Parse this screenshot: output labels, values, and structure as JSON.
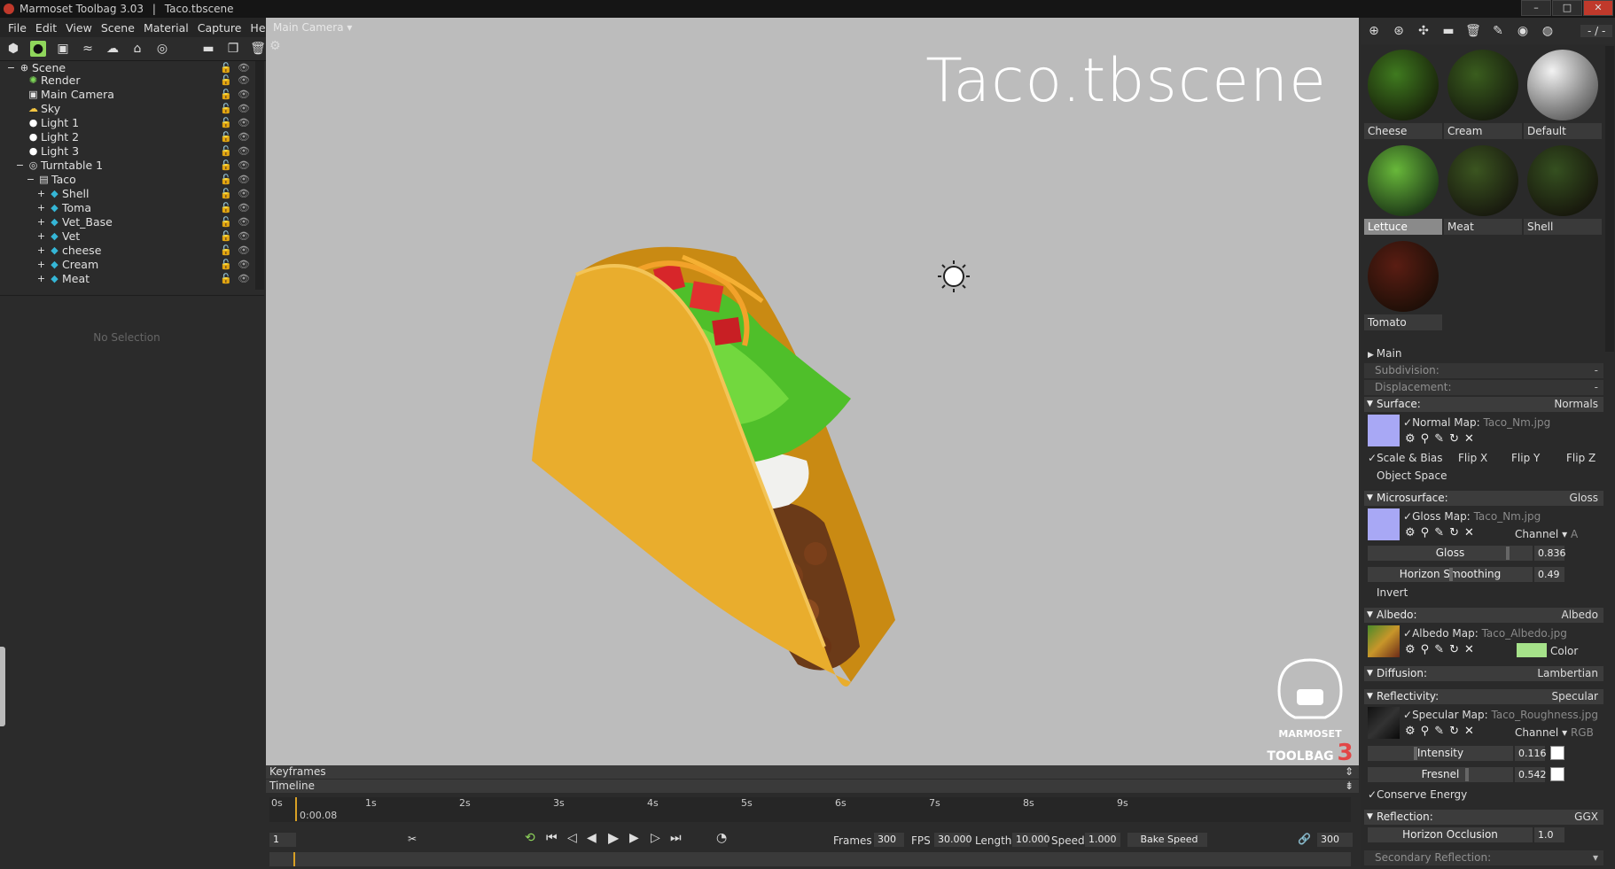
{
  "window": {
    "app_title": "Marmoset Toolbag 3.03",
    "file_title": "Taco.tbscene",
    "separator": "|",
    "minimize": "–",
    "maximize": "□",
    "close": "✕"
  },
  "menu": [
    "File",
    "Edit",
    "View",
    "Scene",
    "Material",
    "Capture",
    "Help"
  ],
  "scene_tree": [
    {
      "label": "Scene",
      "icon": "scene-icon",
      "glyph": "⊕",
      "expander": "−"
    },
    {
      "label": "Render",
      "icon": "render-icon",
      "glyph": "✺",
      "expander": ""
    },
    {
      "label": "Main Camera",
      "icon": "camera-icon",
      "glyph": "▣",
      "expander": ""
    },
    {
      "label": "Sky",
      "icon": "sky-icon",
      "glyph": "☁",
      "expander": ""
    },
    {
      "label": "Light 1",
      "icon": "light-icon",
      "glyph": "●",
      "expander": ""
    },
    {
      "label": "Light 2",
      "icon": "light-icon",
      "glyph": "●",
      "expander": ""
    },
    {
      "label": "Light 3",
      "icon": "light-icon",
      "glyph": "●",
      "expander": ""
    },
    {
      "label": "Turntable 1",
      "icon": "turntable-icon",
      "glyph": "◎",
      "expander": "−"
    },
    {
      "label": "Taco",
      "icon": "model-icon",
      "glyph": "▤",
      "expander": "−"
    },
    {
      "label": "Shell",
      "icon": "mesh-icon",
      "glyph": "◆",
      "expander": "+"
    },
    {
      "label": "Toma",
      "icon": "mesh-icon",
      "glyph": "◆",
      "expander": "+"
    },
    {
      "label": "Vet_Base",
      "icon": "mesh-icon",
      "glyph": "◆",
      "expander": "+"
    },
    {
      "label": "Vet",
      "icon": "mesh-icon",
      "glyph": "◆",
      "expander": "+"
    },
    {
      "label": "cheese",
      "icon": "mesh-icon",
      "glyph": "◆",
      "expander": "+"
    },
    {
      "label": "Cream",
      "icon": "mesh-icon",
      "glyph": "◆",
      "expander": "+"
    },
    {
      "label": "Meat",
      "icon": "mesh-icon",
      "glyph": "◆",
      "expander": "+"
    }
  ],
  "tree_row_controls": {
    "lock": "🔓",
    "eye": "👁"
  },
  "left_panel": {
    "no_selection": "No Selection"
  },
  "viewport": {
    "camera_label": "Main Camera ▾",
    "title": "Taco.tbscene",
    "logo_line1": "MARMOSET",
    "logo_line2": "TOOLBAG",
    "logo_version": "3"
  },
  "right_toolbar": {
    "counter": "- / -"
  },
  "materials": [
    {
      "name": "Cheese",
      "c1": "#3f7a1f",
      "c2": "#1c2a0c"
    },
    {
      "name": "Cream",
      "c1": "#3a5d1e",
      "c2": "#1a220f"
    },
    {
      "name": "Default",
      "c1": "#f2f2f2",
      "c2": "#4b4b4b"
    },
    {
      "name": "Lettuce",
      "c1": "#68b83a",
      "c2": "#24441a"
    },
    {
      "name": "Meat",
      "c1": "#3b5520",
      "c2": "#1b1e10"
    },
    {
      "name": "Shell",
      "c1": "#355020",
      "c2": "#1a1c0e"
    },
    {
      "name": "Tomato",
      "c1": "#5a1d13",
      "c2": "#231008"
    }
  ],
  "props": {
    "main": "Main",
    "subdivision": {
      "label": "Subdivision:",
      "value": "-"
    },
    "displacement": {
      "label": "Displacement:",
      "value": "-"
    },
    "surface": {
      "label": "Surface:",
      "value": "Normals"
    },
    "normal_map": {
      "label": "Normal Map:",
      "file": "Taco_Nm.jpg"
    },
    "scale_bias": "Scale & Bias",
    "flip_x": "Flip X",
    "flip_y": "Flip Y",
    "flip_z": "Flip Z",
    "object_space": "Object Space",
    "microsurface": {
      "label": "Microsurface:",
      "value": "Gloss"
    },
    "gloss_map": {
      "label": "Gloss Map:",
      "file": "Taco_Nm.jpg"
    },
    "channel_label": "Channel",
    "gloss_channel": "A",
    "gloss": {
      "label": "Gloss",
      "value": "0.836"
    },
    "horizon_smoothing": {
      "label": "Horizon Smoothing",
      "value": "0.49"
    },
    "invert": "Invert",
    "albedo": {
      "label": "Albedo:",
      "value": "Albedo"
    },
    "albedo_map": {
      "label": "Albedo Map:",
      "file": "Taco_Albedo.jpg"
    },
    "color_label": "Color",
    "diffusion": {
      "label": "Diffusion:",
      "value": "Lambertian"
    },
    "reflectivity": {
      "label": "Reflectivity:",
      "value": "Specular"
    },
    "specular_map": {
      "label": "Specular Map:",
      "file": "Taco_Roughness.jpg"
    },
    "spec_channel": "RGB",
    "intensity": {
      "label": "Intensity",
      "value": "0.116"
    },
    "fresnel": {
      "label": "Fresnel",
      "value": "0.542"
    },
    "conserve_energy": "Conserve Energy",
    "reflection": {
      "label": "Reflection:",
      "value": "GGX"
    },
    "horizon_occlusion": {
      "label": "Horizon Occlusion",
      "value": "1.0"
    },
    "secondary_reflection": "Secondary Reflection:"
  },
  "timeline": {
    "keyframes": "Keyframes",
    "timeline": "Timeline",
    "ticks": [
      "0s",
      "1s",
      "2s",
      "3s",
      "4s",
      "5s",
      "6s",
      "7s",
      "8s",
      "9s"
    ],
    "current_time": "0:00.08",
    "current_frame": "1",
    "frames_label": "Frames",
    "frames": "300",
    "fps_label": "FPS",
    "fps": "30.000",
    "length_label": "Length",
    "length": "10.000",
    "speed_label": "Speed",
    "speed": "1.000",
    "bake_speed": "Bake Speed",
    "end_frame": "300"
  },
  "colors": {
    "accent_green": "#8fd65b",
    "playhead": "#d8a025",
    "viewport_bg": "#bcbcbc"
  }
}
